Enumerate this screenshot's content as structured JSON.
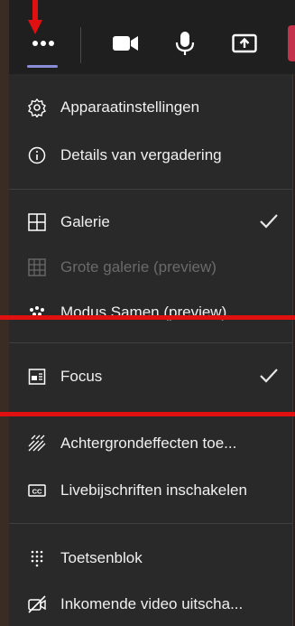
{
  "toolbar": {
    "more_icon": "more-options-icon",
    "camera_icon": "camera-icon",
    "mic_icon": "microphone-icon",
    "share_icon": "share-screen-icon",
    "accent_color": "#8b8cd8",
    "leave_color": "#c4314b"
  },
  "menu": {
    "items": [
      {
        "label": "Apparaatinstellingen",
        "icon": "gear-icon",
        "disabled": false,
        "checked": false
      },
      {
        "label": "Details van vergadering",
        "icon": "info-icon",
        "disabled": false,
        "checked": false
      },
      {
        "label": "Galerie",
        "icon": "gallery-grid-icon",
        "disabled": false,
        "checked": true
      },
      {
        "label": "Grote galerie (preview)",
        "icon": "large-gallery-icon",
        "disabled": true,
        "checked": false
      },
      {
        "label": "Modus Samen (preview)",
        "icon": "together-mode-icon",
        "disabled": false,
        "checked": false
      },
      {
        "label": "Focus",
        "icon": "focus-icon",
        "disabled": false,
        "checked": true
      },
      {
        "label": "Achtergrondeffecten toe...",
        "icon": "background-effects-icon",
        "disabled": false,
        "checked": false
      },
      {
        "label": "Livebijschriften inschakelen",
        "icon": "captions-icon",
        "disabled": false,
        "checked": false
      },
      {
        "label": "Toetsenblok",
        "icon": "keypad-icon",
        "disabled": false,
        "checked": false
      },
      {
        "label": "Inkomende video uitscha...",
        "icon": "video-off-icon",
        "disabled": false,
        "checked": false
      }
    ]
  },
  "annotations": {
    "arrow_color": "#e01010",
    "line_color": "#e01010"
  }
}
